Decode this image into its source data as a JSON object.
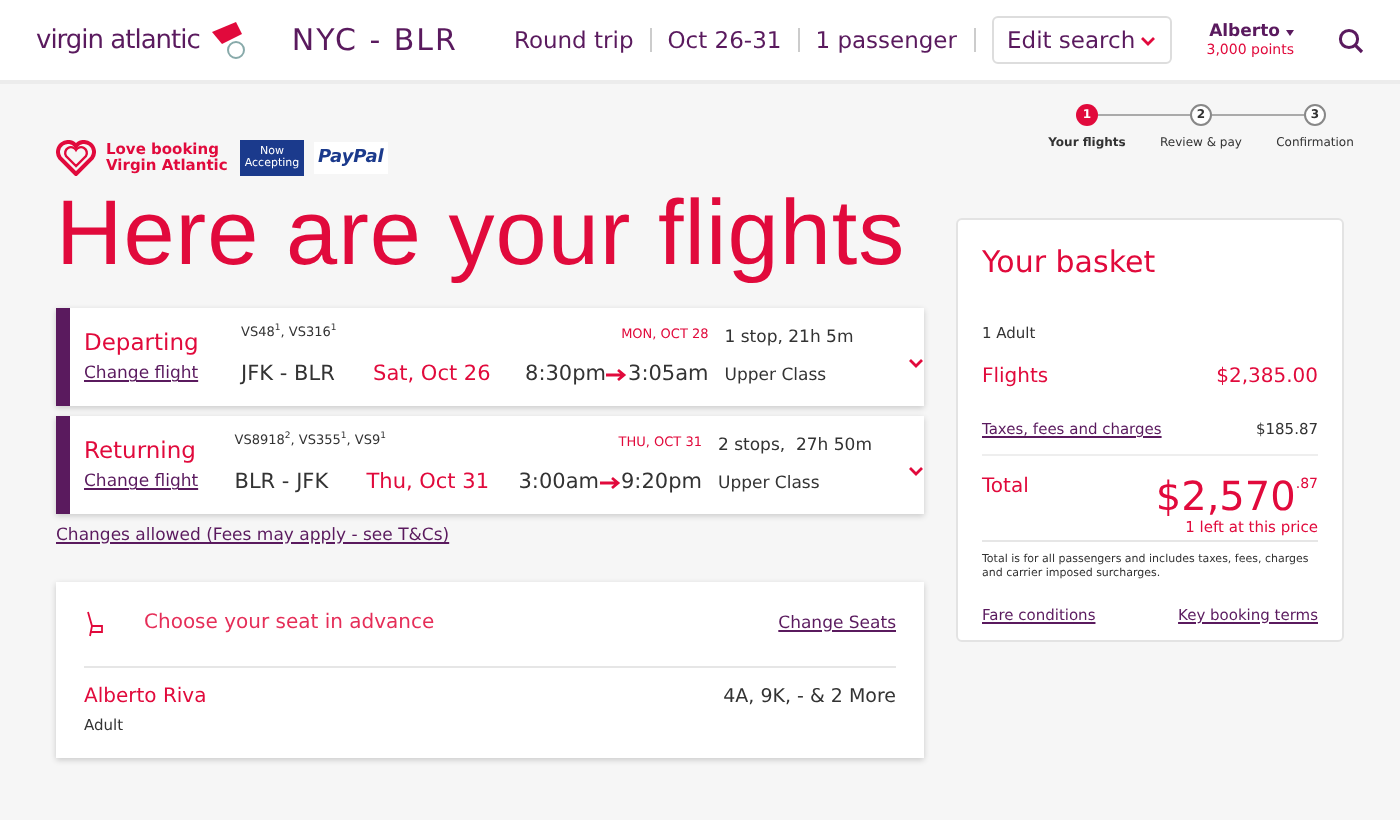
{
  "header": {
    "brand": "virgin atlantic",
    "route": "NYC - BLR",
    "trip": "Round trip",
    "dates": "Oct 26-31",
    "passengers": "1 passenger",
    "edit": "Edit search",
    "user": "Alberto",
    "points": "3,000 points"
  },
  "promo": {
    "love": "Love booking Virgin Atlantic",
    "paypal_note": "Now Accepting",
    "paypal": "PayPal"
  },
  "steps": [
    {
      "number": "1",
      "label": "Your flights",
      "selected": true
    },
    {
      "number": "2",
      "label": "Review & pay",
      "selected": false
    },
    {
      "number": "3",
      "label": "Confirmation",
      "selected": false
    }
  ],
  "title": "Here are your flights",
  "flights": [
    {
      "direction": "Departing",
      "change": "Change flight",
      "numbers": "VS48$^{1}$, VS316$^{1}$",
      "arrival_date": "MON, OCT 28",
      "route": "JFK - BLR",
      "date": "Sat, Oct 26",
      "depart": "8:30pm",
      "arrive": "3:05am",
      "stops": "1 stop, 21h 5m",
      "cabin": "Upper Class"
    },
    {
      "direction": "Returning",
      "change": "Change flight",
      "numbers": "VS8918$^{2}$, VS355$^{1}$, VS9$^{1}$",
      "arrival_date": "THU, OCT 31",
      "route": "BLR - JFK",
      "date": "Thu, Oct 31",
      "depart": "3:00am",
      "arrive": "9:20pm",
      "stops": "2 stops,  27h 50m",
      "cabin": "Upper Class"
    }
  ],
  "changes_link": "Changes allowed (Fees may apply - see T&Cs)",
  "seats": {
    "title": "Choose your seat in advance",
    "change": "Change Seats",
    "passenger": "Alberto Riva",
    "type": "Adult",
    "seats": "4A, 9K, - & 2 More"
  },
  "basket": {
    "title": "Your basket",
    "travellers": "1 Adult",
    "flights_label": "Flights",
    "flights_price": "$2,385.00",
    "taxes_label": "Taxes, fees and charges",
    "taxes_price": "$185.87",
    "total_label": "Total",
    "total_main": "$2,570",
    "total_cents": ".87",
    "availability": "1 left at this price",
    "note": "Total is for all passengers and includes taxes, fees, charges and carrier imposed surcharges.",
    "fare_link": "Fare conditions",
    "terms_link": "Key booking terms"
  }
}
